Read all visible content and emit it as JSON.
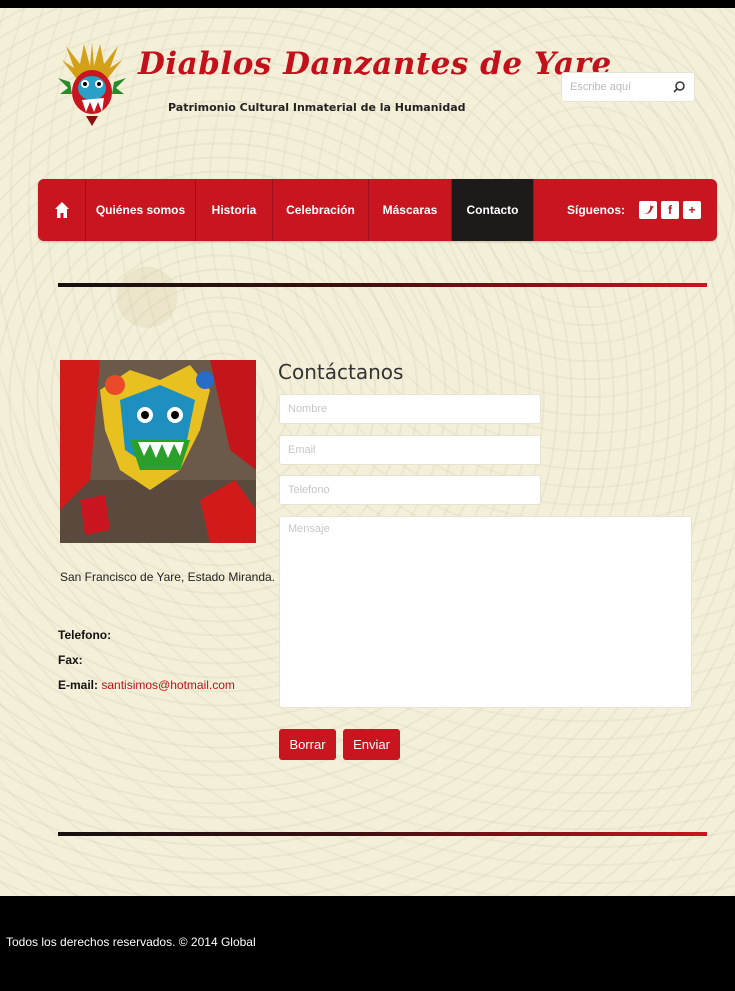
{
  "header": {
    "title": "Diablos Danzantes de Yare",
    "subtitle": "Patrimonio Cultural Inmaterial de la Humanidad",
    "search_placeholder": "Escribe aquí"
  },
  "nav": {
    "items": [
      {
        "label": "Quiénes somos"
      },
      {
        "label": "Historia"
      },
      {
        "label": "Celebración"
      },
      {
        "label": "Máscaras"
      },
      {
        "label": "Contacto"
      }
    ],
    "active": "Contacto",
    "social_label": "Síguenos:",
    "social_icons": [
      "twitter-icon",
      "facebook-icon",
      "google-plus-icon"
    ]
  },
  "contact_info": {
    "address": "San Francisco de Yare, Estado Miranda.",
    "phone_label": "Telefono:",
    "fax_label": "Fax:",
    "email_label": "E-mail:",
    "email_value": "santisimos@hotmail.com"
  },
  "form": {
    "title": "Contáctanos",
    "name_placeholder": "Nombre",
    "email_placeholder": "Email",
    "phone_placeholder": "Telefono",
    "message_placeholder": "Mensaje",
    "clear_label": "Borrar",
    "send_label": "Enviar"
  },
  "footer": {
    "text": "Todos los derechos reservados. © 2014 Global"
  },
  "colors": {
    "accent": "#c8151f",
    "nav_active": "#1e1a1a",
    "background": "#f3efd9",
    "footer": "#000000"
  }
}
